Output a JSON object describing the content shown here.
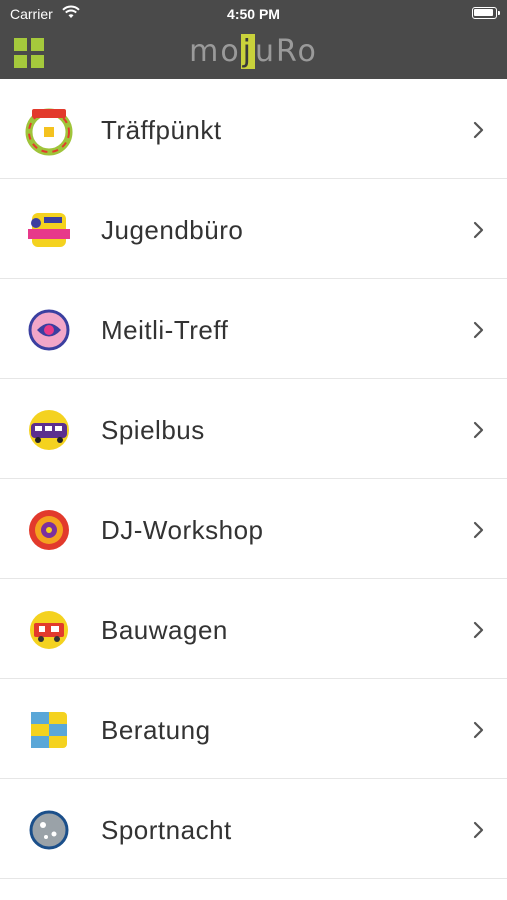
{
  "status": {
    "carrier": "Carrier",
    "time": "4:50 PM"
  },
  "header": {
    "logo_parts": [
      "mo",
      "j",
      "uRo"
    ]
  },
  "items": [
    {
      "label": "Träffpünkt",
      "icon": "traeffpuenkt-logo-icon"
    },
    {
      "label": "Jugendbüro",
      "icon": "jugendbuero-logo-icon"
    },
    {
      "label": "Meitli-Treff",
      "icon": "meitli-treff-logo-icon"
    },
    {
      "label": "Spielbus",
      "icon": "spielbus-logo-icon"
    },
    {
      "label": "DJ-Workshop",
      "icon": "dj-workshop-logo-icon"
    },
    {
      "label": "Bauwagen",
      "icon": "bauwagen-logo-icon"
    },
    {
      "label": "Beratung",
      "icon": "beratung-logo-icon"
    },
    {
      "label": "Sportnacht",
      "icon": "sportnacht-logo-icon"
    }
  ],
  "colors": {
    "header_bg": "#4a4a4a",
    "accent_green": "#a5c93c",
    "chevron": "#555555"
  }
}
